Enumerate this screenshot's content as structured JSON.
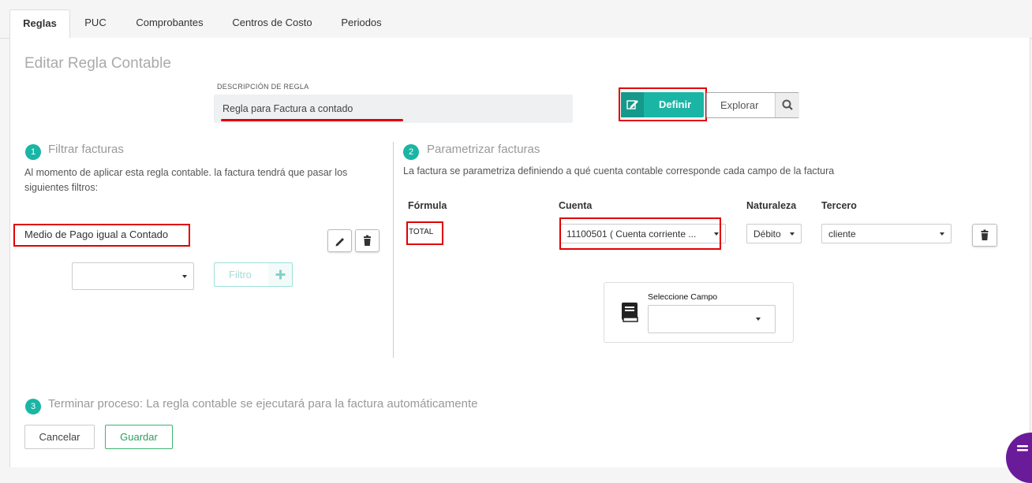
{
  "tabs": [
    {
      "label": "Reglas",
      "active": true
    },
    {
      "label": "PUC"
    },
    {
      "label": "Comprobantes"
    },
    {
      "label": "Centros de Costo"
    },
    {
      "label": "Periodos"
    }
  ],
  "page_title": "Editar Regla Contable",
  "description": {
    "label": "DESCRIPCIÓN DE REGLA",
    "value": "Regla para Factura a contado"
  },
  "mode_buttons": {
    "definir": "Definir",
    "explorar": "Explorar"
  },
  "step1": {
    "number": "1",
    "title": "Filtrar facturas",
    "description": "Al momento de aplicar esta regla contable. la factura tendrá que pasar los siguientes filtros:",
    "filter_item": "Medio de Pago igual a Contado",
    "filter_select_value": "",
    "filter_button": "Filtro"
  },
  "step2": {
    "number": "2",
    "title": "Parametrizar facturas",
    "description": "La factura se parametriza definiendo a qué cuenta contable corresponde cada campo de la factura",
    "columns": {
      "formula": "Fórmula",
      "cuenta": "Cuenta",
      "naturaleza": "Naturaleza",
      "tercero": "Tercero"
    },
    "row": {
      "formula": "TOTAL",
      "cuenta": "11100501 ( Cuenta corriente ...",
      "naturaleza": "Débito",
      "tercero": "cliente"
    },
    "campo": {
      "label": "Seleccione Campo",
      "value": ""
    }
  },
  "step3": {
    "number": "3",
    "title": "Terminar proceso: La regla contable se ejecutará para la factura automáticamente"
  },
  "actions": {
    "cancel": "Cancelar",
    "save": "Guardar"
  },
  "colors": {
    "accent": "#1ab5a5",
    "annotation_red": "#e00000",
    "save_green": "#3cb371",
    "chat_purple": "#6a1b9a"
  }
}
